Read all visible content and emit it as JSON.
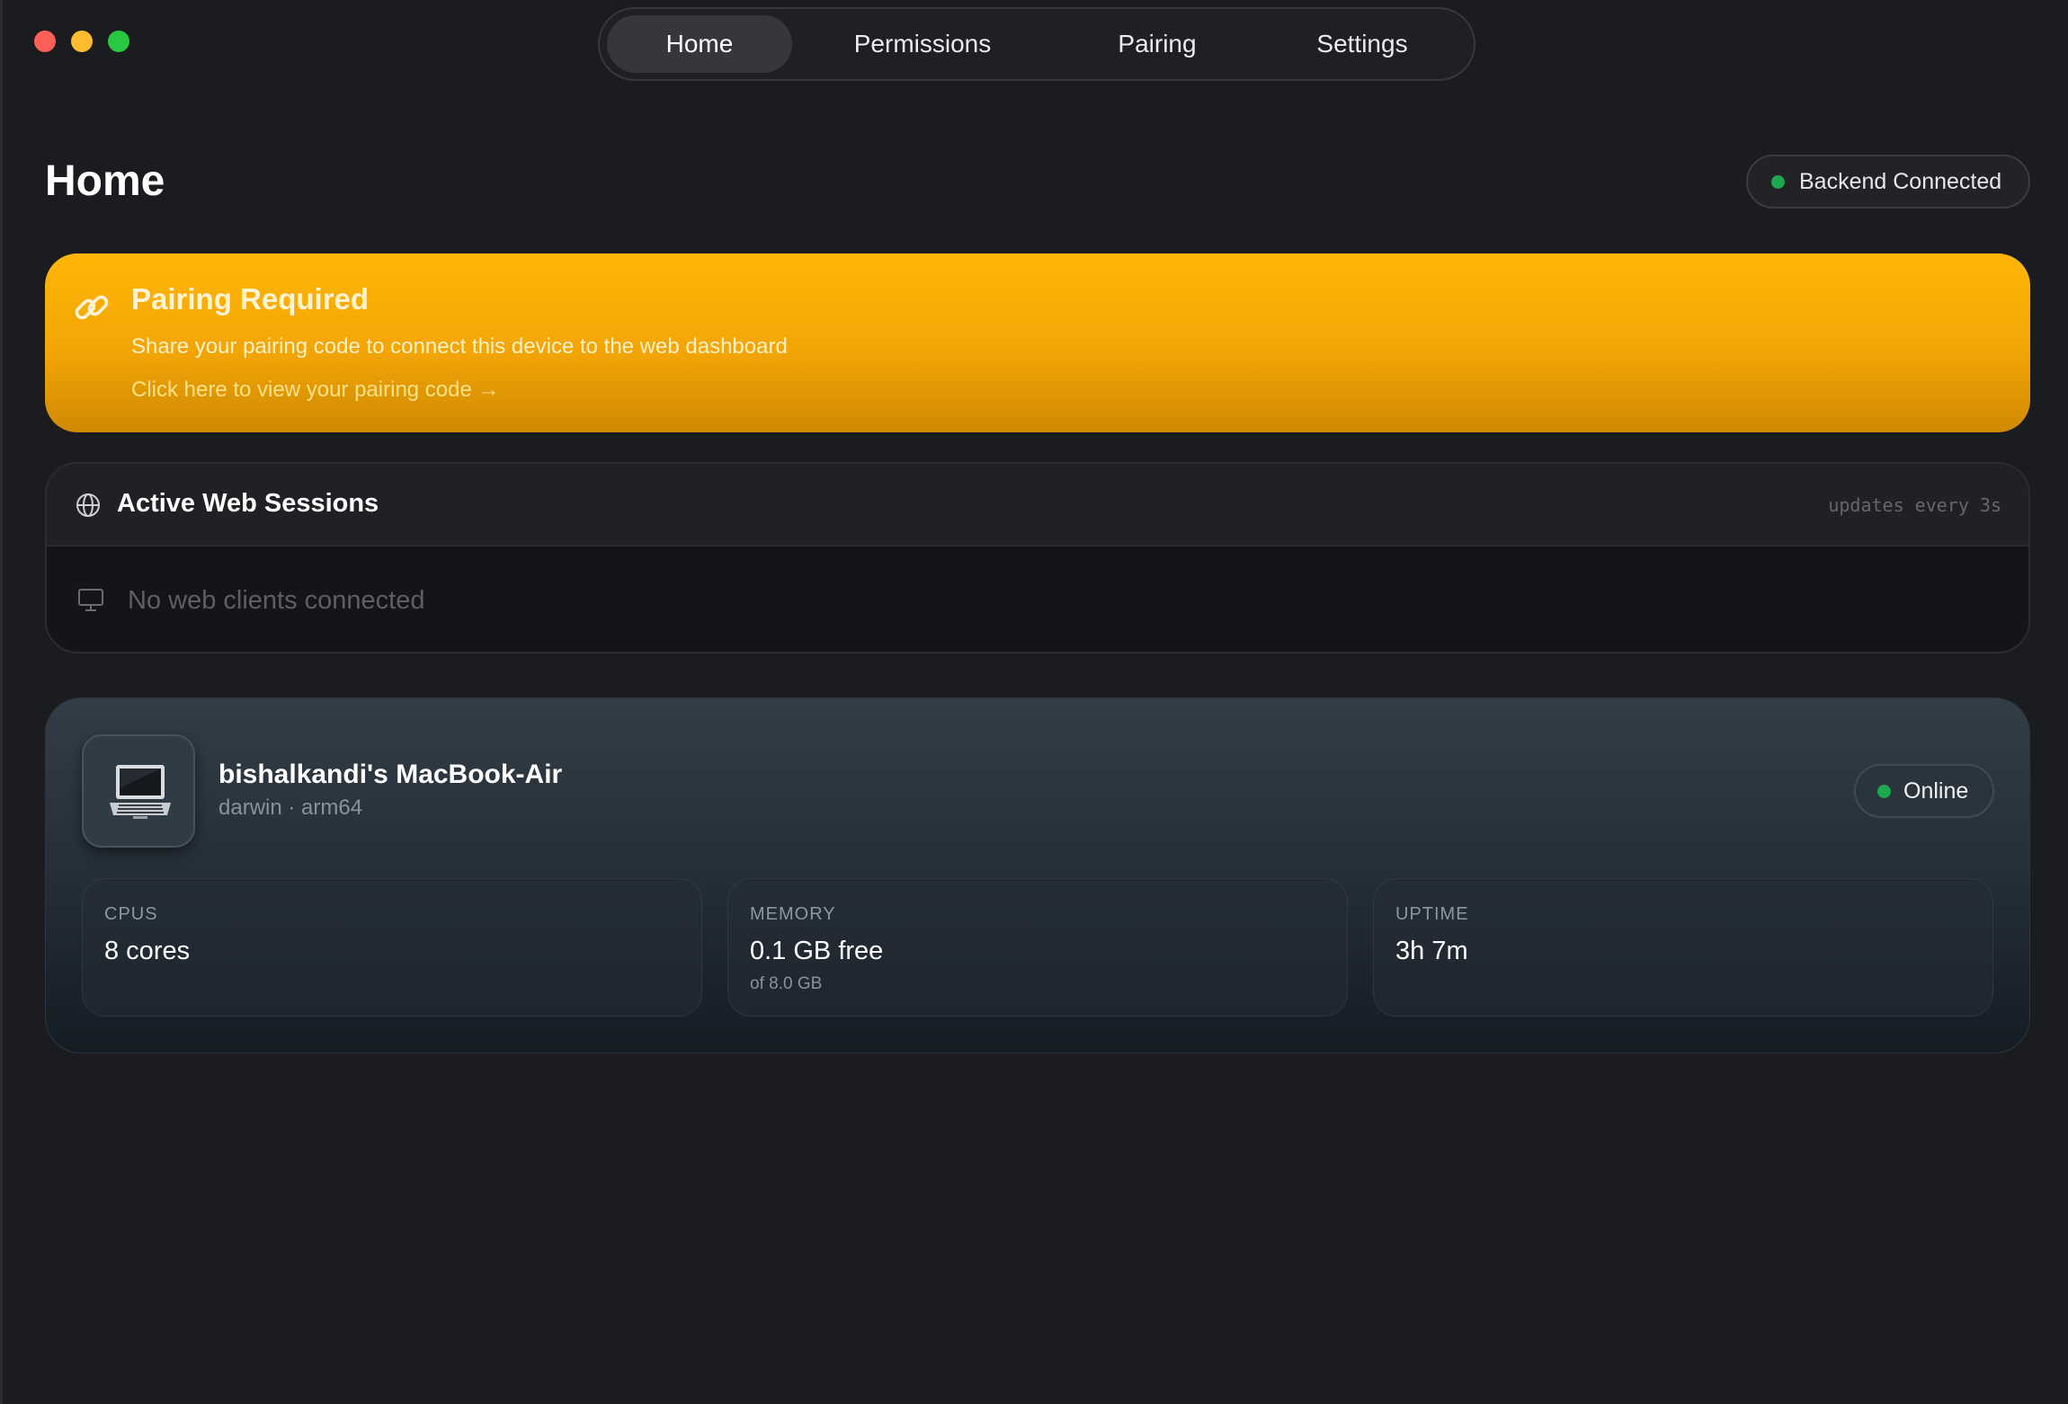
{
  "nav": {
    "tabs": [
      {
        "label": "Home",
        "active": true
      },
      {
        "label": "Permissions",
        "active": false
      },
      {
        "label": "Pairing",
        "active": false
      },
      {
        "label": "Settings",
        "active": false
      }
    ]
  },
  "page": {
    "title": "Home",
    "backend_status": "Backend Connected",
    "backend_status_color": "#1fa650"
  },
  "pairing_banner": {
    "icon": "link-icon",
    "title": "Pairing Required",
    "description": "Share your pairing code to connect this device to the web dashboard",
    "link": "Click here to view your pairing code →",
    "color": "#ffb607"
  },
  "sessions": {
    "icon": "globe-icon",
    "title": "Active Web Sessions",
    "meta": "updates every 3s",
    "empty_icon": "monitor-icon",
    "empty_text": "No web clients connected"
  },
  "device": {
    "icon": "laptop-icon",
    "name": "bishalkandi's MacBook-Air",
    "subtitle": "darwin · arm64",
    "status": "Online",
    "status_color": "#1fa650",
    "stats": {
      "cpus": {
        "label": "CPUS",
        "value": "8 cores"
      },
      "memory": {
        "label": "MEMORY",
        "value": "0.1 GB free",
        "sub": "of 8.0 GB"
      },
      "uptime": {
        "label": "UPTIME",
        "value": "3h 7m"
      }
    }
  }
}
